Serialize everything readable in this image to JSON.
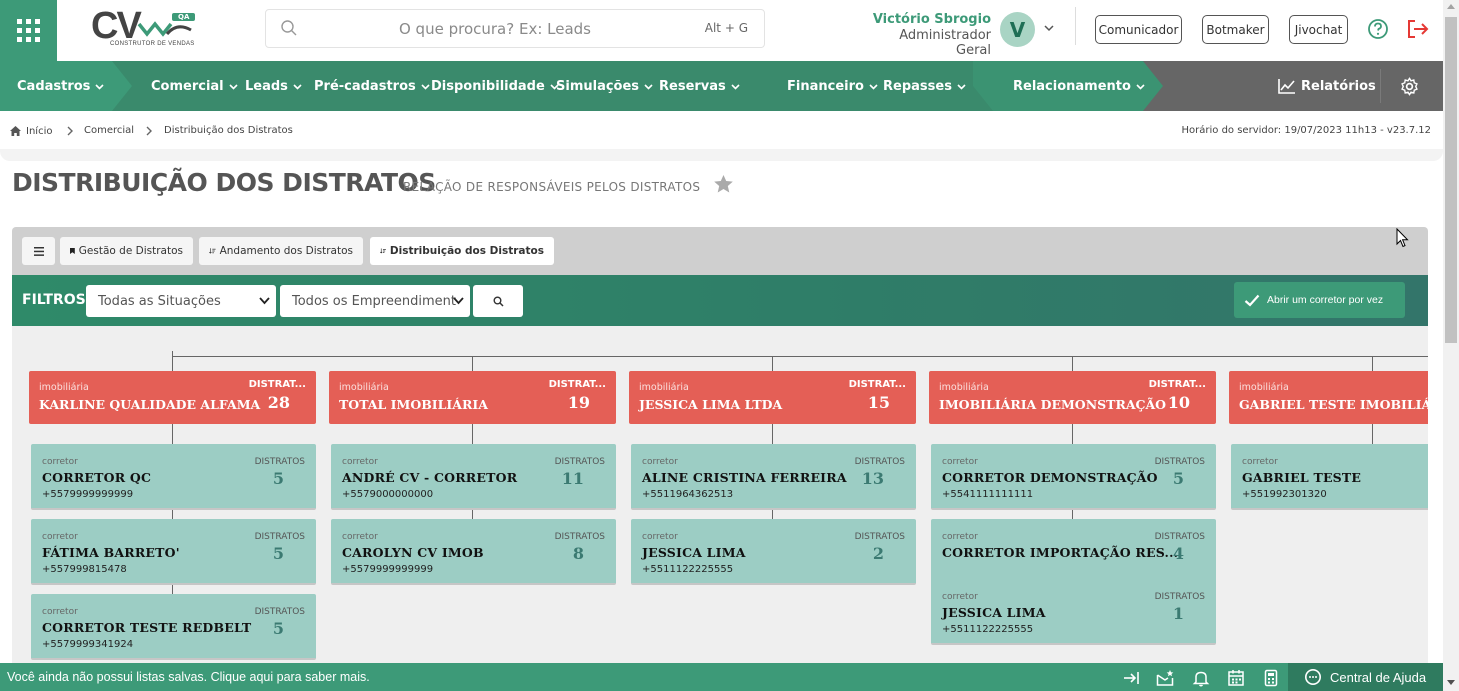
{
  "header": {
    "logo": {
      "brand": "CV",
      "badge": "QA",
      "subtitle": "CONSTRUTOR DE VENDAS"
    },
    "search": {
      "placeholder": "O que procura? Ex: Leads",
      "shortcut": "Alt + G"
    },
    "user": {
      "name": "Victório Sbrogio",
      "role": "Administrador Geral",
      "initial": "V"
    },
    "buttons": [
      {
        "label": "Comunicador"
      },
      {
        "label": "Botmaker"
      },
      {
        "label": "Jivochat"
      }
    ]
  },
  "nav": {
    "items": [
      {
        "label": "Cadastros"
      },
      {
        "label": "Comercial"
      },
      {
        "label": "Leads"
      },
      {
        "label": "Pré-cadastros"
      },
      {
        "label": "Disponibilidade"
      },
      {
        "label": "Simulações"
      },
      {
        "label": "Reservas"
      },
      {
        "label": "Financeiro"
      },
      {
        "label": "Repasses"
      },
      {
        "label": "Relacionamento"
      }
    ],
    "reports": "Relatórios"
  },
  "breadcrumb": {
    "items": [
      "Início",
      "Comercial",
      "Distribuição dos Distratos"
    ],
    "server_time": "Horário do servidor: 19/07/2023 11h13 - v23.7.12"
  },
  "page": {
    "title": "DISTRIBUIÇÃO DOS DISTRATOS",
    "subtitle": "RELAÇÃO DE RESPONSÁVEIS PELOS DISTRATOS"
  },
  "tabs": [
    {
      "label": "Gestão de Distratos",
      "active": false
    },
    {
      "label": "Andamento dos Distratos",
      "active": false
    },
    {
      "label": "Distribuição dos Distratos",
      "active": true
    }
  ],
  "filters": {
    "label": "FILTROS",
    "situacao": "Todas as Situações",
    "empreendimento": "Todos os Empreendiment",
    "open_one": "Abrir um corretor por vez"
  },
  "tree": {
    "imob_label": "imobiliária",
    "cor_label": "corretor",
    "imob_distratos_label": "DISTRAT...",
    "cor_distratos_label": "DISTRATOS",
    "columns": [
      {
        "name": "KARLINE QUALIDADE ALFAMA",
        "distratos": "28",
        "corretores": [
          {
            "name": "CORRETOR QC",
            "phone": "+5579999999999",
            "distratos": "5"
          },
          {
            "name": "FÁTIMA BARRETO'",
            "phone": "+557999815478",
            "distratos": "5"
          },
          {
            "name": "CORRETOR TESTE REDBELT",
            "phone": "+5579999341924",
            "distratos": "5"
          }
        ]
      },
      {
        "name": "TOTAL IMOBILIÁRIA",
        "distratos": "19",
        "corretores": [
          {
            "name": "ANDRÉ CV - CORRETOR",
            "phone": "+5579000000000",
            "distratos": "11"
          },
          {
            "name": "CAROLYN CV IMOB",
            "phone": "+5579999999999",
            "distratos": "8"
          }
        ]
      },
      {
        "name": "JESSICA LIMA LTDA",
        "distratos": "15",
        "corretores": [
          {
            "name": "ALINE CRISTINA FERREIRA",
            "phone": "+5511964362513",
            "distratos": "13"
          },
          {
            "name": "JESSICA LIMA",
            "phone": "+5511122225555",
            "distratos": "2"
          }
        ]
      },
      {
        "name": "IMOBILIÁRIA DEMONSTRAÇÃO",
        "distratos": "10",
        "corretores": [
          {
            "name": "CORRETOR DEMONSTRAÇÃO",
            "phone": "+5541111111111",
            "distratos": "5"
          },
          {
            "name": "CORRETOR IMPORTAÇÃO RES...",
            "phone": "",
            "distratos": "4"
          },
          {
            "name": "JESSICA LIMA",
            "phone": "+5511122225555",
            "distratos": "1"
          }
        ]
      },
      {
        "name": "GABRIEL TESTE IMOBILIÁ",
        "distratos": "",
        "corretores": [
          {
            "name": "GABRIEL TESTE",
            "phone": "+551992301320",
            "distratos": ""
          }
        ]
      }
    ]
  },
  "footer": {
    "message": "Você ainda não possui listas salvas. Clique aqui para saber mais.",
    "help_center": "Central de Ajuda"
  },
  "colors": {
    "brand_green": "#3d9a78",
    "nav_green": "#3a8a6c",
    "imob_red": "#e45f56",
    "corretor_teal": "#9ccdc4"
  }
}
